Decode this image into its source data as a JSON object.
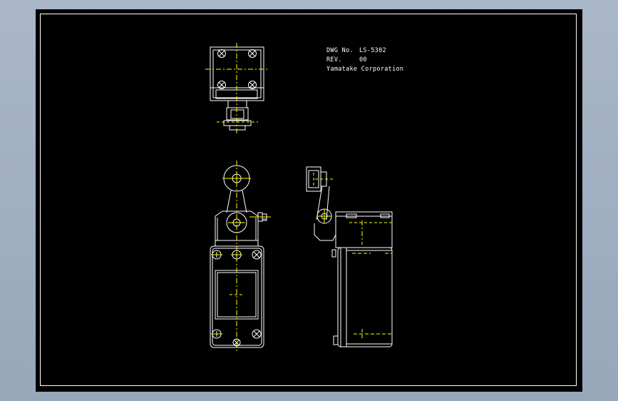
{
  "title_block": {
    "dwg_label": "DWG No.",
    "dwg_value": "LS-5302",
    "rev_label": "REV.",
    "rev_value": "00",
    "company": "Yamatake Corporation"
  },
  "colors": {
    "outside": "#9fafc2",
    "sheet_background": "#000000",
    "outline": "#ffffff",
    "centerline": "#ffff00"
  },
  "views": [
    "top-view",
    "front-view",
    "side-view"
  ]
}
